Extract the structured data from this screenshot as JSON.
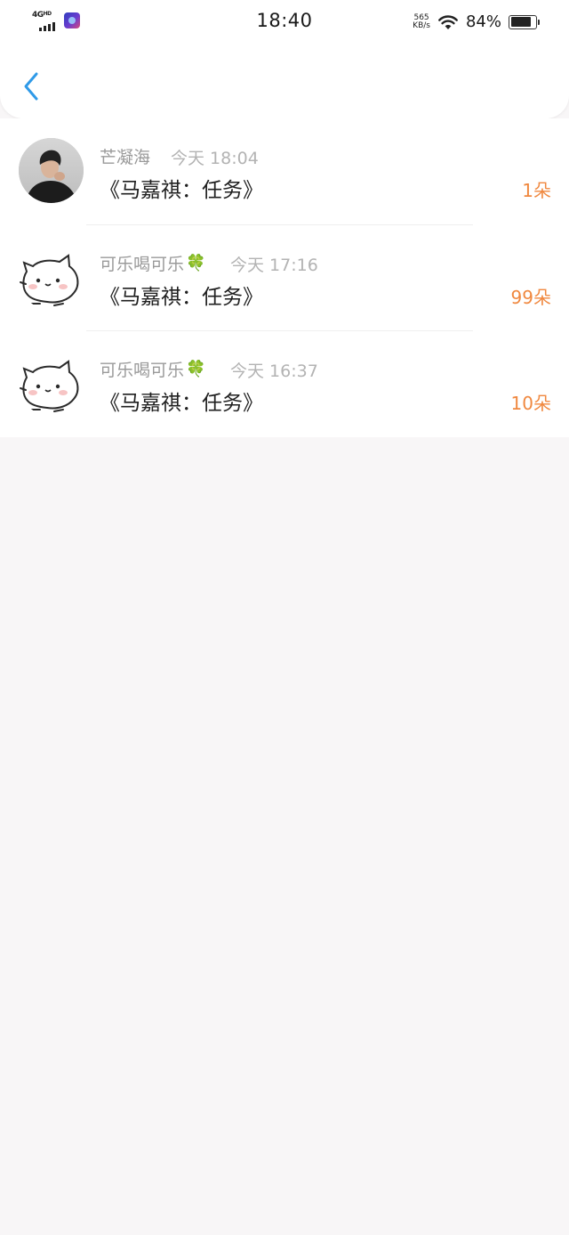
{
  "status_bar": {
    "network": "4G",
    "network_sup": "HD",
    "time": "18:40",
    "speed_value": "565",
    "speed_unit": "KB/s",
    "battery_percent": "84%",
    "battery_level": 0.84
  },
  "nav": {
    "back_icon": "chevron-left-icon",
    "accent_color": "#2f9ae8"
  },
  "gifts": [
    {
      "sender": "芒凝海",
      "clover": "",
      "time": "今天 18:04",
      "title": "《马嘉祺：任务》",
      "amount": "1朵",
      "avatar": "photo"
    },
    {
      "sender": "可乐喝可乐",
      "clover": "🍀",
      "time": "今天 17:16",
      "title": "《马嘉祺：任务》",
      "amount": "99朵",
      "avatar": "cat-sticker"
    },
    {
      "sender": "可乐喝可乐",
      "clover": "🍀",
      "time": "今天 16:37",
      "title": "《马嘉祺：任务》",
      "amount": "10朵",
      "avatar": "cat-sticker"
    }
  ],
  "colors": {
    "amount": "#f0883f",
    "background": "#f8f6f7"
  }
}
